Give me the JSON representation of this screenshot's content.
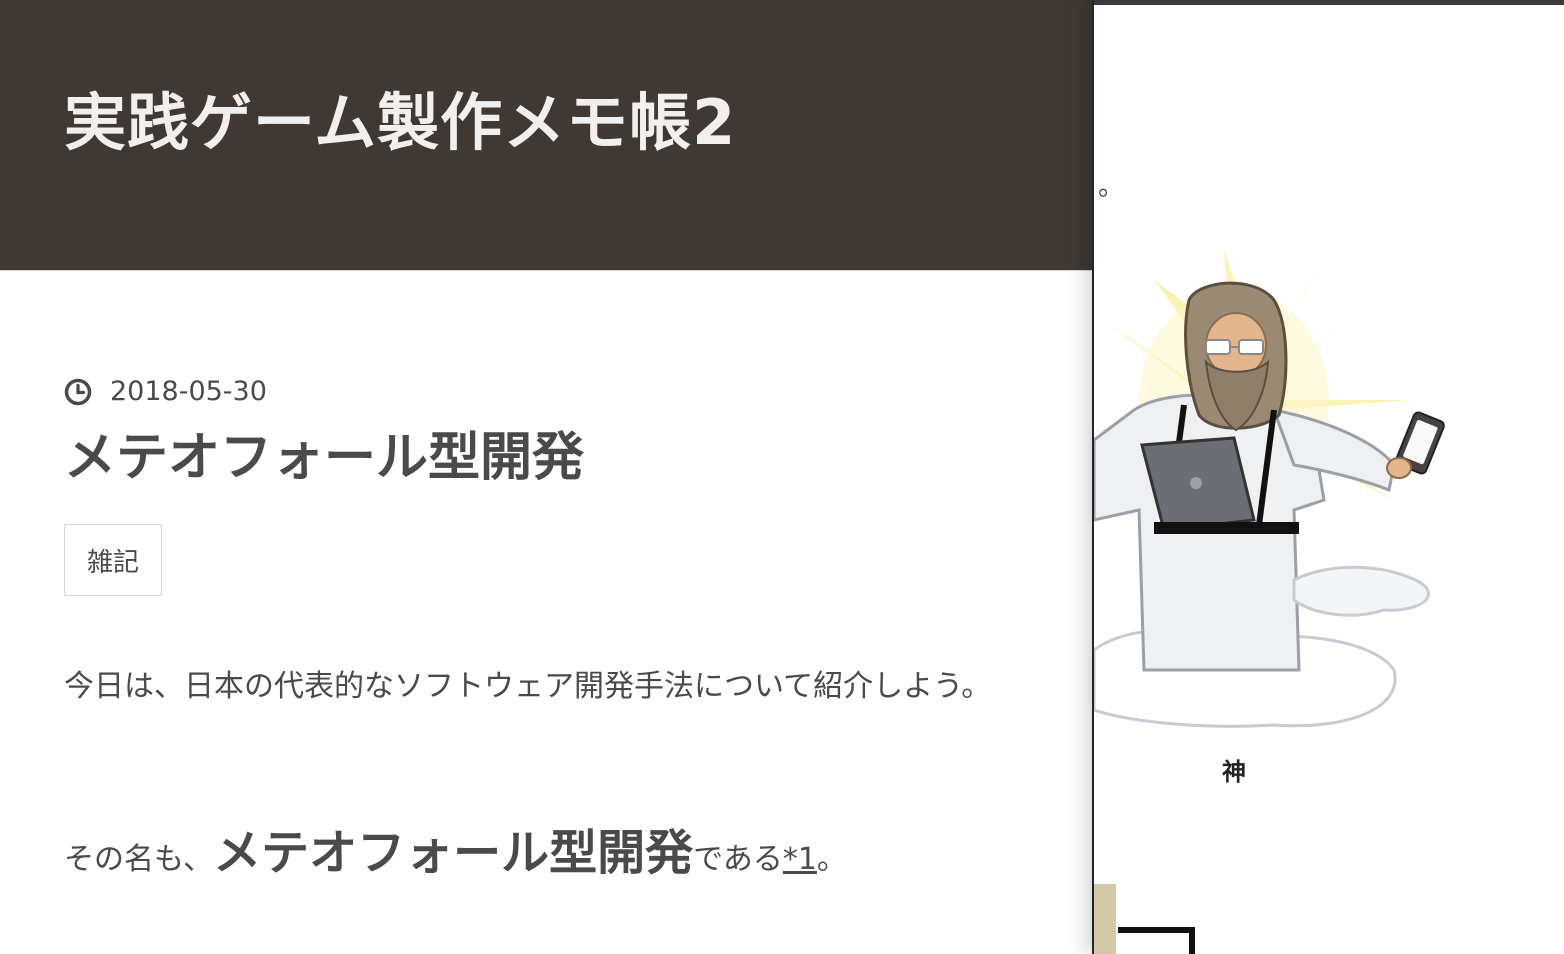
{
  "blog": {
    "title": "実践ゲーム製作メモ帳2"
  },
  "post": {
    "date": "2018-05-30",
    "title": "メテオフォール型開発",
    "category": "雑記",
    "paragraph1": "今日は、日本の代表的なソフトウェア開発手法について紹介しよう。",
    "paragraph2_prefix": "その名も、",
    "paragraph2_emph": "メテオフォール型開発",
    "paragraph2_suffix": "である",
    "paragraph2_footnote": "*1",
    "paragraph2_end": "。"
  },
  "side_panel": {
    "fragment": "。",
    "caption": "神"
  },
  "colors": {
    "header_bg": "#3f3833",
    "header_text": "#f2f0ee",
    "body_text": "#4a4a4a"
  },
  "icons": {
    "date": "clock-icon"
  }
}
